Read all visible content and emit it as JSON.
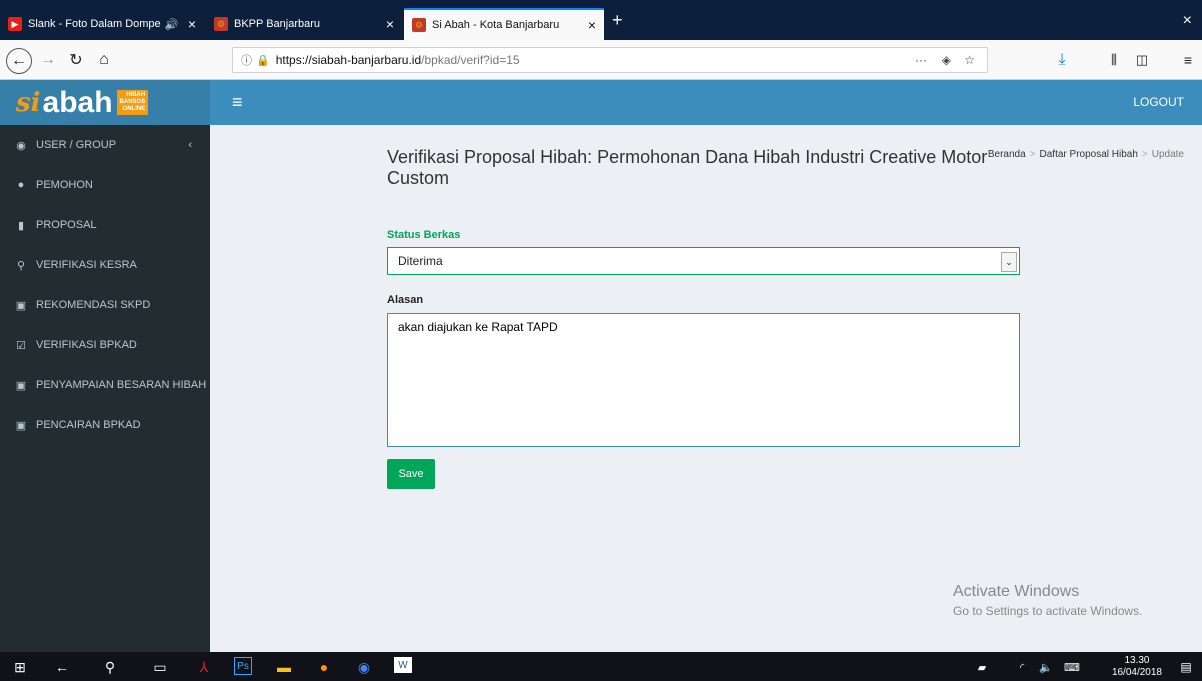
{
  "browser": {
    "tabs": [
      {
        "label": "Slank - Foto Dalam Dompe",
        "close": "×"
      },
      {
        "label": "BKPP Banjarbaru",
        "close": "×"
      },
      {
        "label": "Si Abah - Kota Banjarbaru",
        "close": "×"
      }
    ],
    "new_tab": "+",
    "window_close": "×",
    "url_host": "https://siabah-banjarbaru.id",
    "url_path": "/bpkad/verif?id=15",
    "more": "···"
  },
  "app": {
    "logo_si": "si",
    "logo_abah": "abah",
    "logo_tag": [
      "HIBAH",
      "BANSOS",
      "ONLINE"
    ],
    "logout": "LOGOUT"
  },
  "sidebar": {
    "items": [
      {
        "label": "USER / GROUP",
        "icon": "user-circle-icon"
      },
      {
        "label": "PEMOHON",
        "icon": "user-icon"
      },
      {
        "label": "PROPOSAL",
        "icon": "file-icon"
      },
      {
        "label": "VERIFIKASI KESRA",
        "icon": "search-icon"
      },
      {
        "label": "REKOMENDASI SKPD",
        "icon": "money-icon"
      },
      {
        "label": "VERIFIKASI BPKAD",
        "icon": "check-square-icon"
      },
      {
        "label": "PENYAMPAIAN BESARAN HIBAH",
        "icon": "money-icon"
      },
      {
        "label": "PENCAIRAN BPKAD",
        "icon": "money-icon"
      }
    ]
  },
  "breadcrumb": [
    "Beranda",
    "Daftar Proposal Hibah",
    "Update"
  ],
  "page": {
    "title": "Verifikasi Proposal Hibah: Permohonan Dana Hibah Industri Creative Motor Custom",
    "status_label": "Status Berkas",
    "status_value": "Diterima",
    "reason_label": "Alasan",
    "reason_value": "akan diajukan ke Rapat TAPD",
    "save_label": "Save"
  },
  "watermark": {
    "line1": "Activate Windows",
    "line2": "Go to Settings to activate Windows."
  },
  "taskbar": {
    "time": "13.30",
    "date": "16/04/2018"
  },
  "colors": {
    "header": "#3c8dbc",
    "sidebar": "#222d32",
    "success": "#00a65a",
    "accent": "#f39c12"
  }
}
